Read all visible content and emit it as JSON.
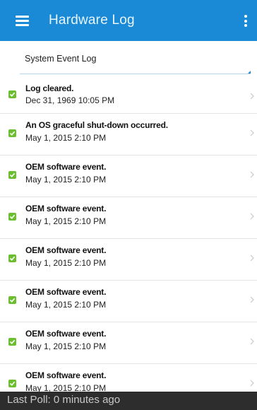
{
  "app_bar": {
    "title": "Hardware Log",
    "menu_icon": "hamburger-menu-icon",
    "overflow_icon": "more-vert-icon",
    "color": "#1a8ad6"
  },
  "log_selector": {
    "selected": "System Event Log"
  },
  "entries": [
    {
      "title": "Log cleared.",
      "date": "Dec 31, 1969 10:05 PM",
      "status_icon": "check-icon"
    },
    {
      "title": "An OS graceful shut-down occurred.",
      "date": "May 1, 2015 2:10 PM",
      "status_icon": "check-icon"
    },
    {
      "title": "OEM software event.",
      "date": "May 1, 2015 2:10 PM",
      "status_icon": "check-icon"
    },
    {
      "title": "OEM software event.",
      "date": "May 1, 2015 2:10 PM",
      "status_icon": "check-icon"
    },
    {
      "title": "OEM software event.",
      "date": "May 1, 2015 2:10 PM",
      "status_icon": "check-icon"
    },
    {
      "title": "OEM software event.",
      "date": "May 1, 2015 2:10 PM",
      "status_icon": "check-icon"
    },
    {
      "title": "OEM software event.",
      "date": "May 1, 2015 2:10 PM",
      "status_icon": "check-icon"
    },
    {
      "title": "OEM software event.",
      "date": "May 1, 2015 2:10 PM",
      "status_icon": "check-icon"
    }
  ],
  "status_bar": {
    "text": "Last Poll: 0 minutes ago"
  },
  "colors": {
    "ok_green": "#6bbf2e",
    "status_bg": "#2d2d2d"
  }
}
